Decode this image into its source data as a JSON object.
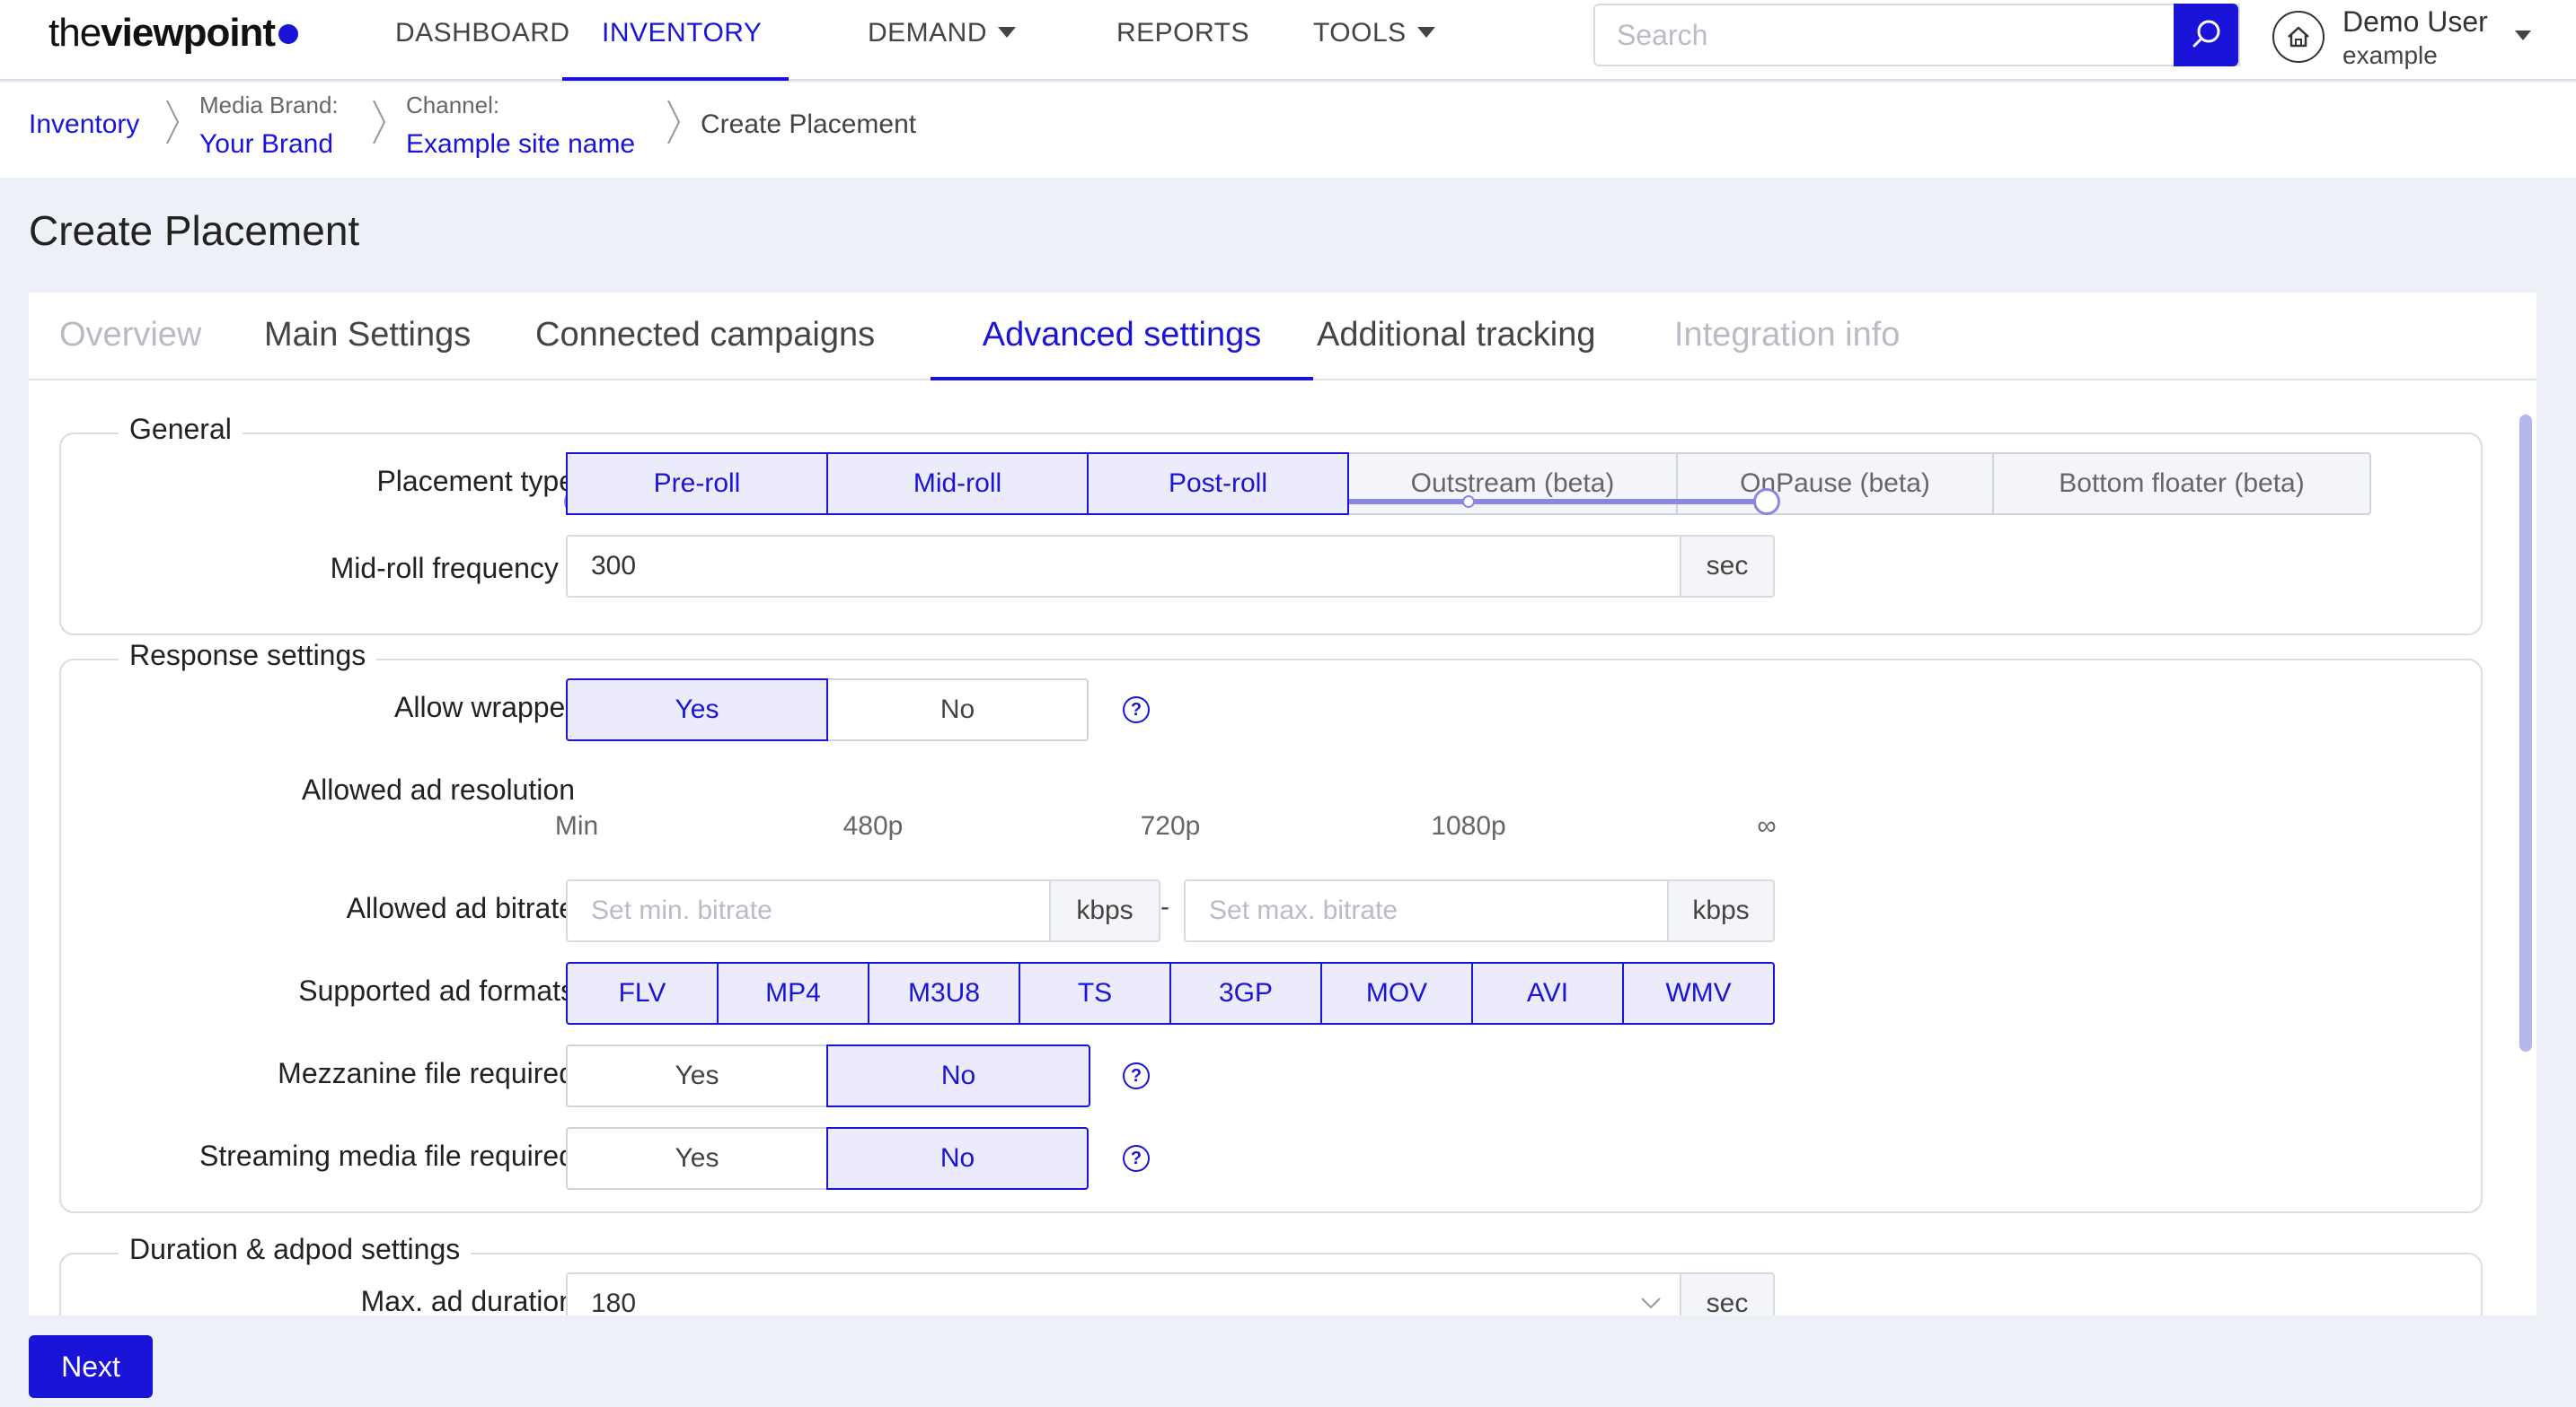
{
  "header": {
    "logo_light": "the",
    "logo_bold": "viewpoint",
    "nav": [
      {
        "label": "DASHBOARD",
        "dropdown": false,
        "active": false
      },
      {
        "label": "INVENTORY",
        "dropdown": false,
        "active": true
      },
      {
        "label": "DEMAND",
        "dropdown": true,
        "active": false
      },
      {
        "label": "REPORTS",
        "dropdown": false,
        "active": false
      },
      {
        "label": "TOOLS",
        "dropdown": true,
        "active": false
      }
    ],
    "search": {
      "placeholder": "Search",
      "value": ""
    },
    "user": {
      "name": "Demo User",
      "sub": "example"
    }
  },
  "breadcrumb": {
    "root": "Inventory",
    "brand_caption": "Media Brand:",
    "brand": "Your Brand",
    "channel_caption": "Channel:",
    "channel": "Example site name",
    "current": "Create Placement"
  },
  "page_title": "Create Placement",
  "tabs": [
    {
      "label": "Overview",
      "state": "disabled"
    },
    {
      "label": "Main Settings",
      "state": "normal"
    },
    {
      "label": "Connected campaigns",
      "state": "normal"
    },
    {
      "label": "Advanced settings",
      "state": "active"
    },
    {
      "label": "Additional tracking",
      "state": "normal"
    },
    {
      "label": "Integration info",
      "state": "disabled"
    }
  ],
  "general": {
    "legend": "General",
    "placement_type_label": "Placement type",
    "placement_types": [
      {
        "label": "Pre-roll",
        "selected": true
      },
      {
        "label": "Mid-roll",
        "selected": true
      },
      {
        "label": "Post-roll",
        "selected": true
      },
      {
        "label": "Outstream (beta)",
        "selected": false
      },
      {
        "label": "OnPause (beta)",
        "selected": false
      },
      {
        "label": "Bottom floater (beta)",
        "selected": false
      }
    ],
    "midroll_label": "Mid-roll frequency",
    "midroll_required": "*",
    "midroll_value": "300",
    "midroll_unit": "sec"
  },
  "response": {
    "legend": "Response settings",
    "allow_wrapper_label": "Allow wrapper",
    "allow_wrapper_yes": "Yes",
    "allow_wrapper_no": "No",
    "allow_wrapper_value": "Yes",
    "resolution_label": "Allowed ad resolution",
    "resolution_stops": [
      "Min",
      "480p",
      "720p",
      "1080p",
      "∞"
    ],
    "resolution_range": [
      "Min",
      "∞"
    ],
    "bitrate_label": "Allowed ad bitrate",
    "bitrate_min_placeholder": "Set min. bitrate",
    "bitrate_max_placeholder": "Set max. bitrate",
    "bitrate_unit": "kbps",
    "bitrate_dash": "-",
    "formats_label": "Supported ad formats",
    "formats": [
      {
        "label": "FLV",
        "selected": true
      },
      {
        "label": "MP4",
        "selected": true
      },
      {
        "label": "M3U8",
        "selected": true
      },
      {
        "label": "TS",
        "selected": true
      },
      {
        "label": "3GP",
        "selected": true
      },
      {
        "label": "MOV",
        "selected": true
      },
      {
        "label": "AVI",
        "selected": true
      },
      {
        "label": "WMV",
        "selected": true
      }
    ],
    "mezzanine_label": "Mezzanine file required",
    "mezzanine_yes": "Yes",
    "mezzanine_no": "No",
    "mezzanine_value": "No",
    "streaming_label": "Streaming media file required",
    "streaming_yes": "Yes",
    "streaming_no": "No",
    "streaming_value": "No"
  },
  "duration": {
    "legend": "Duration & adpod settings",
    "max_duration_label": "Max. ad duration",
    "max_duration_value": "180",
    "max_duration_unit": "sec"
  },
  "footer": {
    "next_label": "Next"
  },
  "colors": {
    "accent": "#1a14d8",
    "selected_bg": "#ecebfb",
    "slider": "#8b86e4",
    "page_bg": "#eef0f7"
  },
  "icons": [
    "search-icon",
    "home-icon",
    "chevron-down-icon",
    "help-icon",
    "breadcrumb-chevron-icon"
  ]
}
